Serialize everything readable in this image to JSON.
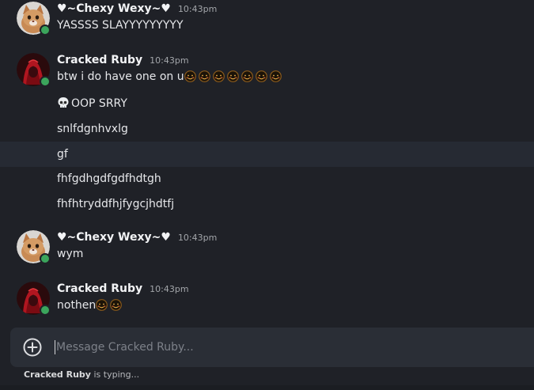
{
  "messages": [
    {
      "author": "♥~Chexy Wexy~♥",
      "time": "10:43pm",
      "lines": [
        "YASSSS SLAYYYYYYYYY"
      ]
    },
    {
      "author": "Cracked Ruby",
      "time": "10:43pm",
      "first_line_text": "btw i do have one on u",
      "first_line_emoji_count": 7,
      "lines": [
        "OOP SRRY",
        "snlfdgnhvxlg",
        "gf",
        "fhfgdhgdfgdfhdtgh",
        "fhfhtryddfhjfygcjhdtfj"
      ]
    },
    {
      "author": "♥~Chexy Wexy~♥",
      "time": "10:43pm",
      "lines": [
        "wym"
      ]
    },
    {
      "author": "Cracked Ruby",
      "time": "10:43pm",
      "first_line_text": "nothen",
      "first_line_emoji_count": 2
    }
  ],
  "input": {
    "placeholder": "Message Cracked Ruby..."
  },
  "typing": {
    "user": "Cracked Ruby",
    "suffix": "is typing..."
  },
  "colors": {
    "background": "#1f2127",
    "online": "#3ba55c",
    "hover_row": "#262a33",
    "input_bg": "#2a2e36"
  },
  "icons": [
    "cat-avatar",
    "ruby-avatar",
    "online-status-icon",
    "blush-emoji-icon",
    "skull-emoji-icon",
    "add-attachment-icon"
  ]
}
